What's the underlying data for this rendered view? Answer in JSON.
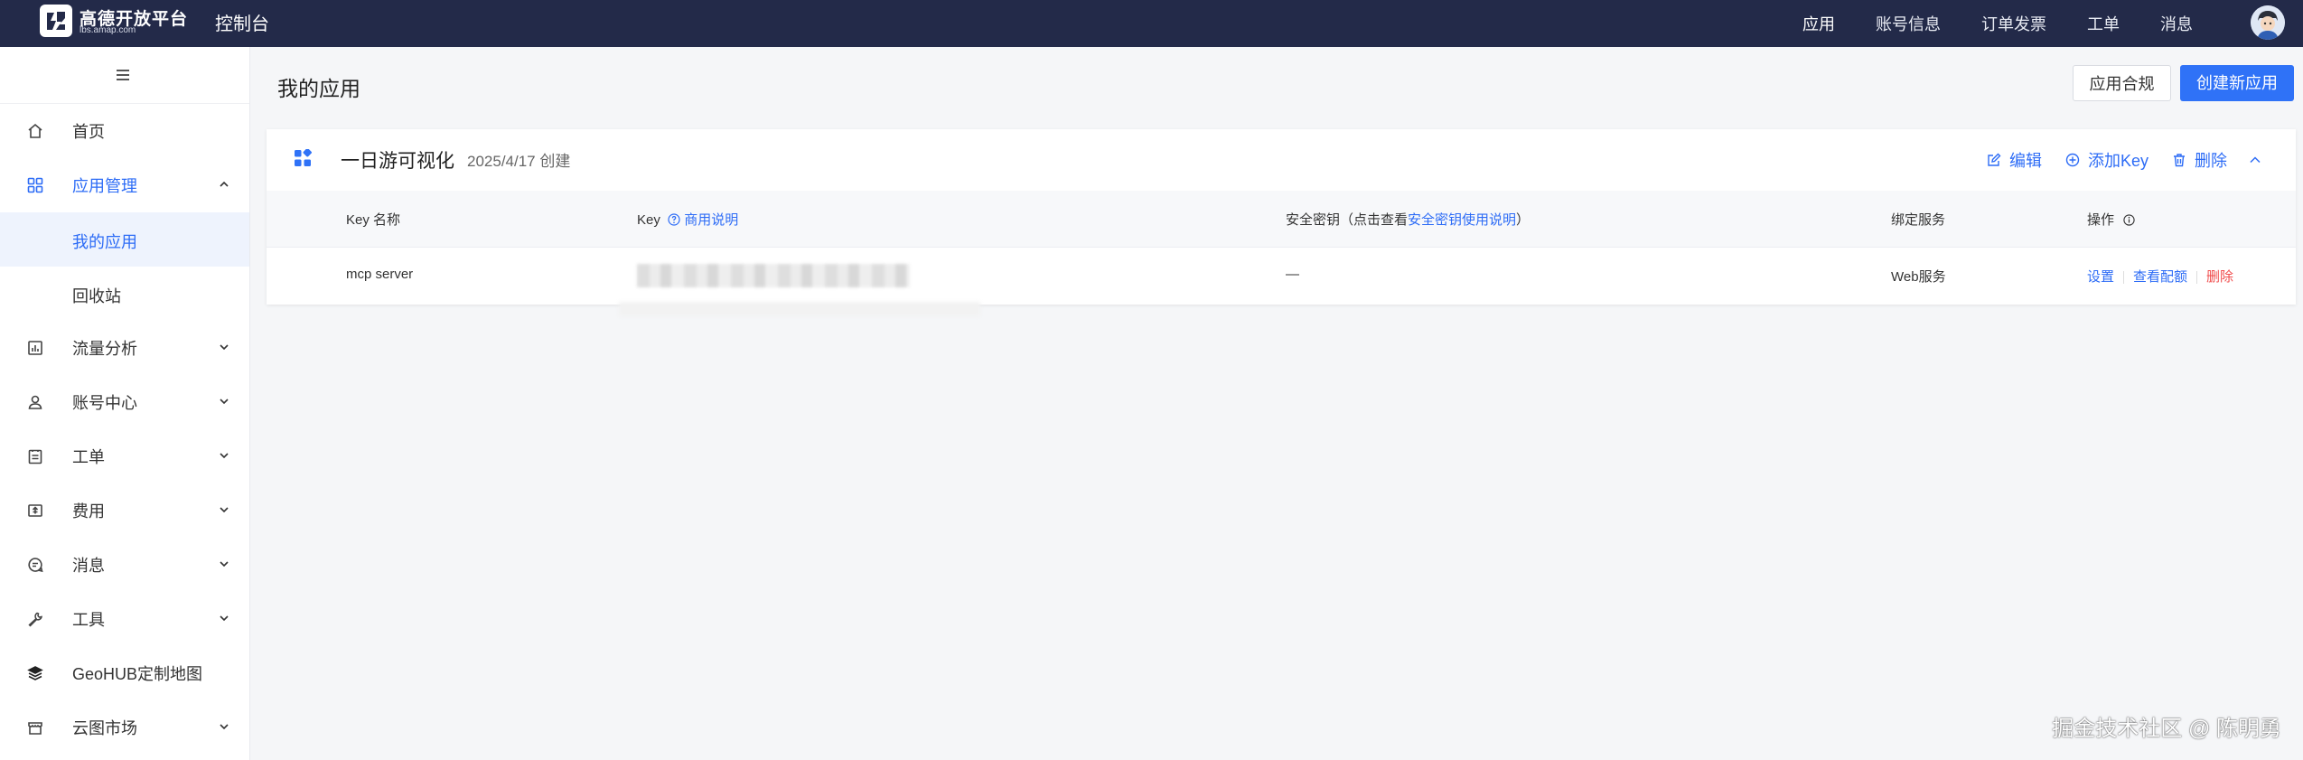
{
  "header": {
    "logo_text": "高德开放平台",
    "logo_sub": "lbs.amap.com",
    "console_title": "控制台",
    "nav": [
      "应用",
      "账号信息",
      "订单发票",
      "工单",
      "消息"
    ]
  },
  "sidebar": {
    "items": [
      {
        "label": "首页",
        "icon": "home-icon"
      },
      {
        "label": "应用管理",
        "icon": "grid-icon",
        "expanded": true,
        "children": [
          {
            "label": "我的应用",
            "active": true
          },
          {
            "label": "回收站"
          }
        ]
      },
      {
        "label": "流量分析",
        "icon": "chart-icon"
      },
      {
        "label": "账号中心",
        "icon": "user-icon"
      },
      {
        "label": "工单",
        "icon": "ticket-icon"
      },
      {
        "label": "费用",
        "icon": "cost-icon"
      },
      {
        "label": "消息",
        "icon": "message-icon"
      },
      {
        "label": "工具",
        "icon": "wrench-icon"
      },
      {
        "label": "GeoHUB定制地图",
        "icon": "layers-icon"
      },
      {
        "label": "云图市场",
        "icon": "store-icon"
      }
    ]
  },
  "main": {
    "page_title": "我的应用",
    "compliance_label": "应用合规",
    "create_label": "创建新应用",
    "app": {
      "name": "一日游可视化",
      "created": "2025/4/17 创建",
      "actions": {
        "edit": "编辑",
        "add_key": "添加Key",
        "delete": "删除"
      }
    },
    "table": {
      "headers": {
        "key_name": "Key 名称",
        "key": "Key",
        "key_help": "商用说明",
        "secret_prefix": "安全密钥（点击查看",
        "secret_link": "安全密钥使用说明",
        "secret_suffix": "）",
        "service": "绑定服务",
        "ops": "操作"
      },
      "rows": [
        {
          "key_name": "mcp server",
          "secret": "—",
          "service": "Web服务",
          "ops": [
            "设置",
            "查看配额",
            "删除"
          ]
        }
      ]
    }
  },
  "watermark": "掘金技术社区 @ 陈明勇",
  "colors": {
    "topbar": "#232a49",
    "accent": "#2f72f7",
    "danger": "#f04b4b"
  }
}
